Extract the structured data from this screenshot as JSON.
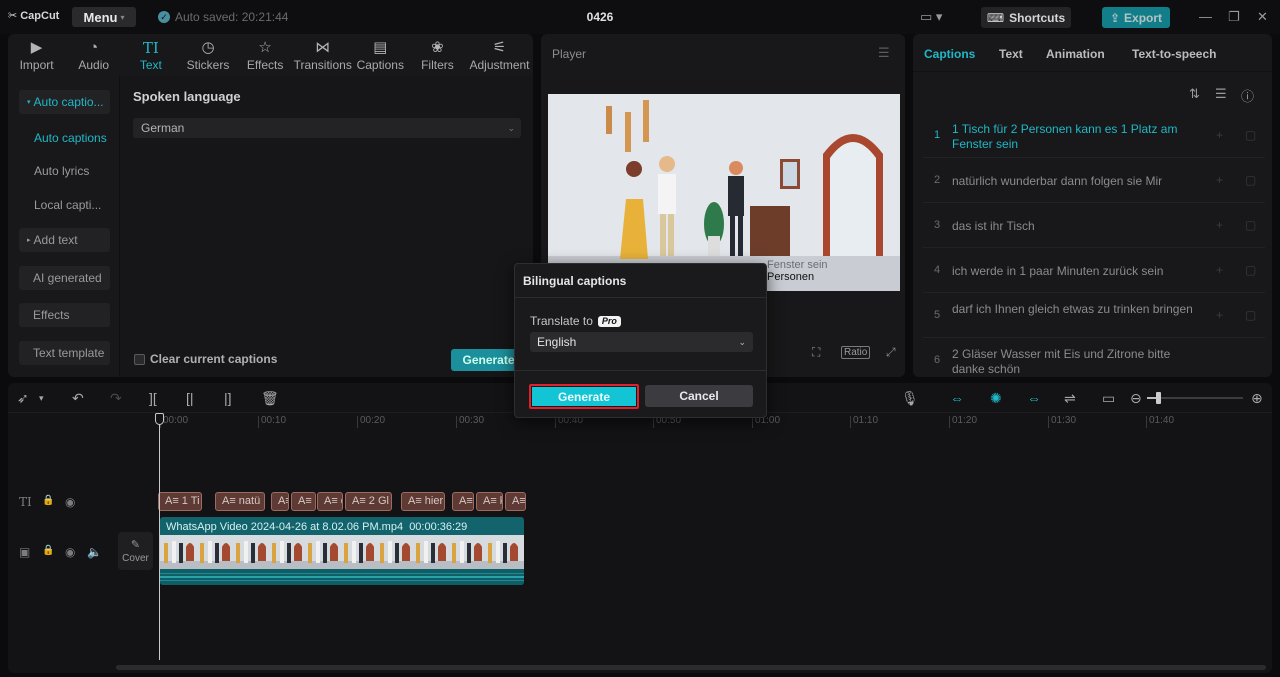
{
  "titlebar": {
    "logo": "CapCut",
    "menu_label": "Menu",
    "autosave": "Auto saved: 20:21:44",
    "project_title": "0426",
    "shortcuts_label": "Shortcuts",
    "export_label": "Export"
  },
  "toolbar": {
    "items": [
      {
        "label": "Import",
        "icon": "import-icon"
      },
      {
        "label": "Audio",
        "icon": "audio-icon"
      },
      {
        "label": "Text",
        "icon": "text-icon",
        "active": true
      },
      {
        "label": "Stickers",
        "icon": "stickers-icon"
      },
      {
        "label": "Effects",
        "icon": "effects-icon"
      },
      {
        "label": "Transitions",
        "icon": "transitions-icon"
      },
      {
        "label": "Captions",
        "icon": "captions-icon"
      },
      {
        "label": "Filters",
        "icon": "filters-icon"
      },
      {
        "label": "Adjustment",
        "icon": "adjustment-icon"
      }
    ]
  },
  "sidebar": {
    "auto_captions_group": "Auto captio...",
    "auto_captions": "Auto captions",
    "auto_lyrics": "Auto lyrics",
    "local_captions": "Local capti...",
    "add_text": "Add text",
    "ai_generated": "AI generated",
    "effects": "Effects",
    "text_template": "Text template"
  },
  "auto_captions_panel": {
    "spoken_language_label": "Spoken language",
    "spoken_language_value": "German",
    "clear_captions_label": "Clear current captions",
    "generate_label": "Generate"
  },
  "player": {
    "title": "Player",
    "subtitle_line1": "Fenster sein",
    "subtitle_line2": "Personen",
    "ratio_label": "Ratio"
  },
  "right_panel": {
    "tabs": [
      "Captions",
      "Text",
      "Animation",
      "Text-to-speech"
    ],
    "captions": [
      {
        "num": "1",
        "text": "1 Tisch für 2 Personen kann es 1 Platz am Fenster sein",
        "active": true
      },
      {
        "num": "2",
        "text": "natürlich wunderbar dann folgen sie Mir"
      },
      {
        "num": "3",
        "text": "das ist ihr Tisch"
      },
      {
        "num": "4",
        "text": "ich werde in 1 paar Minuten zurück sein"
      },
      {
        "num": "5",
        "text": "darf ich Ihnen gleich etwas zu trinken bringen"
      },
      {
        "num": "6",
        "text": "2 Gläser Wasser mit Eis und Zitrone bitte danke schön"
      }
    ]
  },
  "timeline": {
    "ticks": [
      "00:00",
      "00:10",
      "00:20",
      "00:30",
      "00:40",
      "00:50",
      "01:00",
      "01:10",
      "01:20",
      "01:30",
      "01:40"
    ],
    "text_clips": [
      "A≡ 1 Ti",
      "A≡ natü",
      "A≡",
      "A≡ i",
      "A≡ d",
      "A≡ 2 Gl",
      "A≡ hier",
      "A≡",
      "A≡ k",
      "A≡"
    ],
    "video_clip_name": "WhatsApp Video 2024-04-26 at 8.02.06 PM.mp4",
    "video_clip_duration": "00:00:36:29",
    "cover_label": "Cover"
  },
  "dialog": {
    "title": "Bilingual captions",
    "translate_label": "Translate to",
    "pro_badge": "Pro",
    "translate_value": "English",
    "generate_label": "Generate",
    "cancel_label": "Cancel"
  },
  "colors": {
    "accent": "#1fb8c7",
    "highlight_border": "#e0202a",
    "text_clip": "#5e3a34",
    "video_clip": "#12636b"
  }
}
